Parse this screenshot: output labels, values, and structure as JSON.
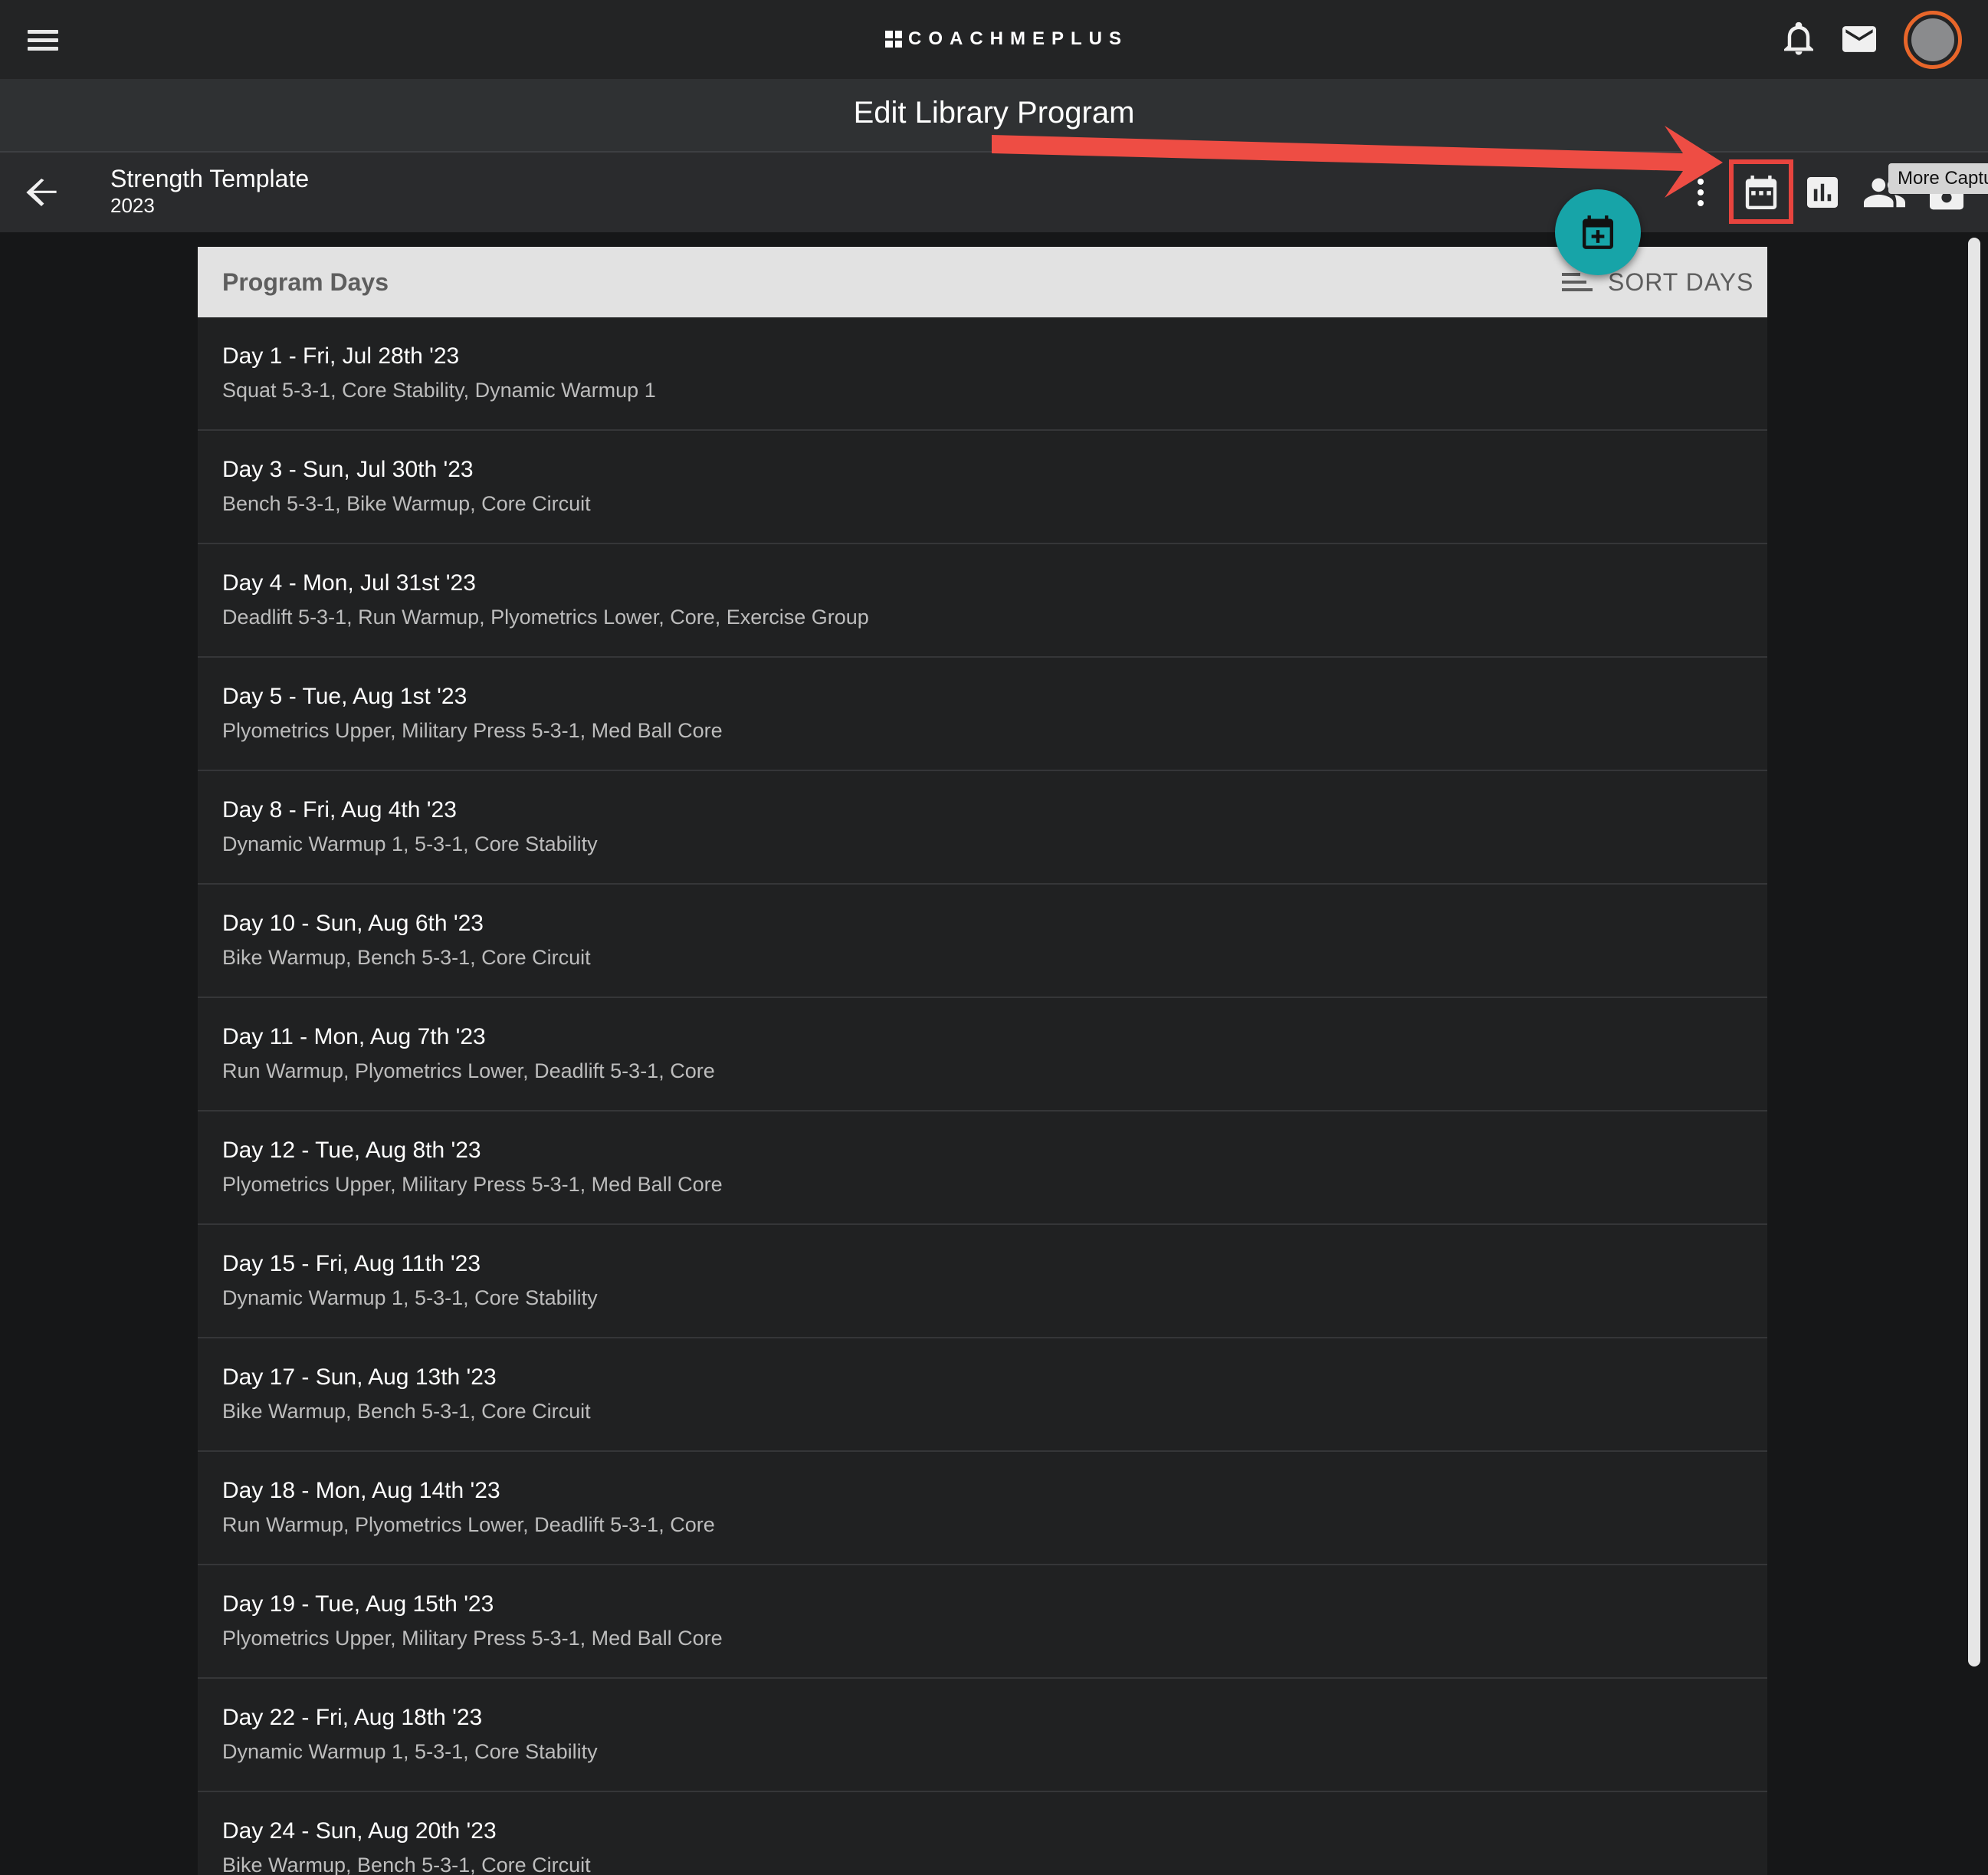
{
  "app": {
    "brand": "COACHMEPLUS"
  },
  "header": {
    "icons": [
      "menu-icon",
      "bell-icon",
      "mail-icon",
      "avatar"
    ]
  },
  "title_bar": {
    "title": "Edit Library Program"
  },
  "program": {
    "name": "Strength Template",
    "year": "2023",
    "toolbar_icons": [
      "more-vert-icon",
      "calendar-icon",
      "bar-chart-icon",
      "group-icon",
      "camera-icon"
    ],
    "tooltip": "More Captu"
  },
  "fab": {
    "icon": "calendar-add-icon",
    "color": "#17a4a8"
  },
  "annotation": {
    "arrow_color": "#e8443e",
    "highlight_target": "calendar-icon"
  },
  "list": {
    "header": "Program Days",
    "sort_label": "SORT DAYS",
    "days": [
      {
        "title": "Day 1 - Fri, Jul 28th '23",
        "subtitle": "Squat 5-3-1, Core Stability, Dynamic Warmup 1"
      },
      {
        "title": "Day 3 - Sun, Jul 30th '23",
        "subtitle": "Bench 5-3-1, Bike Warmup, Core Circuit"
      },
      {
        "title": "Day 4 - Mon, Jul 31st '23",
        "subtitle": "Deadlift 5-3-1, Run Warmup, Plyometrics Lower, Core, Exercise Group"
      },
      {
        "title": "Day 5 - Tue, Aug 1st '23",
        "subtitle": "Plyometrics Upper, Military Press 5-3-1, Med Ball Core"
      },
      {
        "title": "Day 8 - Fri, Aug 4th '23",
        "subtitle": "Dynamic Warmup 1, 5-3-1, Core Stability"
      },
      {
        "title": "Day 10 - Sun, Aug 6th '23",
        "subtitle": "Bike Warmup, Bench 5-3-1, Core Circuit"
      },
      {
        "title": "Day 11 - Mon, Aug 7th '23",
        "subtitle": "Run Warmup, Plyometrics Lower, Deadlift 5-3-1, Core"
      },
      {
        "title": "Day 12 - Tue, Aug 8th '23",
        "subtitle": "Plyometrics Upper, Military Press 5-3-1, Med Ball Core"
      },
      {
        "title": "Day 15 - Fri, Aug 11th '23",
        "subtitle": "Dynamic Warmup 1, 5-3-1, Core Stability"
      },
      {
        "title": "Day 17 - Sun, Aug 13th '23",
        "subtitle": "Bike Warmup, Bench 5-3-1, Core Circuit"
      },
      {
        "title": "Day 18 - Mon, Aug 14th '23",
        "subtitle": "Run Warmup, Plyometrics Lower, Deadlift 5-3-1, Core"
      },
      {
        "title": "Day 19 - Tue, Aug 15th '23",
        "subtitle": "Plyometrics Upper, Military Press 5-3-1, Med Ball Core"
      },
      {
        "title": "Day 22 - Fri, Aug 18th '23",
        "subtitle": "Dynamic Warmup 1, 5-3-1, Core Stability"
      },
      {
        "title": "Day 24 - Sun, Aug 20th '23",
        "subtitle": "Bike Warmup, Bench 5-3-1, Core Circuit"
      }
    ]
  }
}
